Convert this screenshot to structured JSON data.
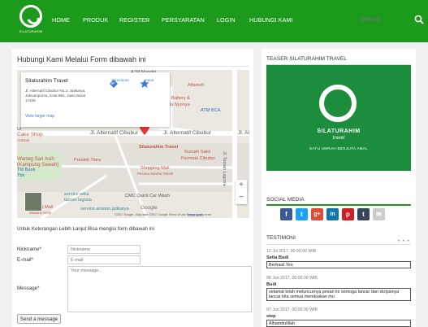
{
  "header": {
    "logo_text": "SILATURAHIM",
    "nav": [
      "HOME",
      "PRODUK",
      "REGISTER",
      "PERSYARATAN",
      "LOGIN",
      "HUBUNGI KAMI"
    ],
    "search_placeholder": "Search",
    "brand_color": "#1b9a1b"
  },
  "contact": {
    "title": "Hubungi Kami Melalui Form dibawah ini",
    "map": {
      "info_title": "Silaturahim Travel",
      "info_address": "Jl. Alternatif Cibubur No.2, Jatikarya, Jatisampurna, Kota Bks, Jawa Barat 17435",
      "directions_label": "Directions",
      "save_label": "Save",
      "larger_map_label": "View larger map",
      "labels": {
        "a1": "A1M Mandiri",
        "alfamidi": "Alfamidi",
        "battery": "Battery &",
        "nyonya": "da Nyonya",
        "atm_bca": "ATM BCA",
        "ur": "Ur",
        "cake_shop": "Cake Shop",
        "arasan": "AraSari",
        "road_alt1": "Jl. Alternatif Cibubur",
        "road_alt2": "Jl. Alternatif Cibubur",
        "road_alt3": "Jl. Al",
        "silaturahim": "Silaturahim Travel",
        "warteg": "Warteg Sari Asih",
        "kampung": "(Kampung Sawah)",
        "pondok": "Pondok Tiara",
        "rs": "Rumah Sakit",
        "permata": "Permata Cibubur",
        "shopping": "Shopping Mall",
        "pesona": "Pesona Saraha Tehnik",
        "tm_bank": "TM Bank",
        "tbk": "Tbk",
        "taman": "Jl. Taman Laguna",
        "wika": "service wika",
        "laguna": "taman laguna",
        "cmc": "CMC Quick Car Wash",
        "mall": "ing Mall",
        "mutiara": "Mutiara Arnik",
        "aniston": "service aniston jatikarya",
        "google": "Google",
        "atm_bri": "ATM BRI"
      },
      "footer": "©2017 Google - Map data ©2017 Google    Terms of Use    Report a map error",
      "zoom_in": "+",
      "zoom_out": "−"
    },
    "form_caption": "Untuk Keterangan Lebih Lanjut Bisa mengisi form dibawah ini",
    "fields": {
      "nickname_label": "Nickname*",
      "nickname_placeholder": "Nickname",
      "email_label": "E-mail*",
      "email_placeholder": "E-mail",
      "message_label": "Message*",
      "message_placeholder": "Your message..."
    },
    "send_label": "Send a message"
  },
  "sidebar": {
    "teaser": {
      "title": "TEASER SILATURAHIM TRAVEL",
      "brand": "SILATURAHIM",
      "sub": "travel",
      "tagline": "SATU UMRAH BERJUTA AMAL"
    },
    "social": {
      "title": "SOCIAL MEDIA",
      "icons": [
        {
          "name": "facebook",
          "glyph": "f",
          "color": "#3b5998"
        },
        {
          "name": "twitter",
          "glyph": "t",
          "color": "#1da1f2"
        },
        {
          "name": "google-plus",
          "glyph": "g+",
          "color": "#dd4b39"
        },
        {
          "name": "linkedin",
          "glyph": "in",
          "color": "#0e76a8"
        },
        {
          "name": "pinterest",
          "glyph": "p",
          "color": "#cb2027"
        },
        {
          "name": "tumblr",
          "glyph": "t",
          "color": "#35465c"
        },
        {
          "name": "email",
          "glyph": "✉",
          "color": "#cccccc"
        }
      ]
    },
    "testimoni": {
      "title": "TESTIMONI",
      "dots": "• • •",
      "items": [
        {
          "date": "12 Jul 2017, 00:00:00 WIB",
          "name": "Setia Budi",
          "text": "Berhasil Yes"
        },
        {
          "date": "08 Jun 2017, 00:00:00 WIB",
          "name": "Budi",
          "text": "selamat telah meluncurnya pesan ini semoga lancar dan skripsinya lancar kita semua mendoakan mu"
        },
        {
          "date": "07 Jun 2017, 00:00:00 WIB",
          "name": "step",
          "text": "Alhamdulillah"
        }
      ]
    }
  }
}
